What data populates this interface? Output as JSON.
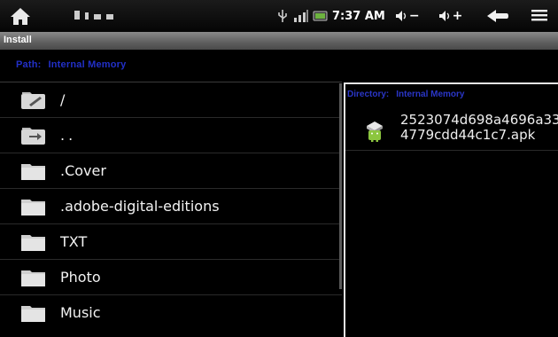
{
  "status_bar": {
    "time": "7:37 AM",
    "icons": [
      "home-icon",
      "usb-icon",
      "signal-icon",
      "battery-icon",
      "volume-down-icon",
      "volume-up-icon",
      "back-icon",
      "menu-icon"
    ],
    "volume_down_label": "−",
    "volume_up_label": "+"
  },
  "title_bar": {
    "title": "Install"
  },
  "path": {
    "label": "Path:",
    "value": "Internal Memory"
  },
  "files": [
    {
      "name": "/",
      "icon": "folder-root-icon"
    },
    {
      "name": "..",
      "icon": "folder-up-icon"
    },
    {
      "name": ".Cover",
      "icon": "folder-icon"
    },
    {
      "name": ".adobe-digital-editions",
      "icon": "folder-icon"
    },
    {
      "name": "TXT",
      "icon": "folder-icon"
    },
    {
      "name": "Photo",
      "icon": "folder-icon"
    },
    {
      "name": "Music",
      "icon": "folder-icon"
    }
  ],
  "directory_panel": {
    "label": "Directory:",
    "value": "Internal Memory",
    "items": [
      {
        "line1": "2523074d698a4696a33",
        "line2": "4779cdd44c1c7.apk",
        "icon": "android-apk-icon"
      }
    ]
  }
}
